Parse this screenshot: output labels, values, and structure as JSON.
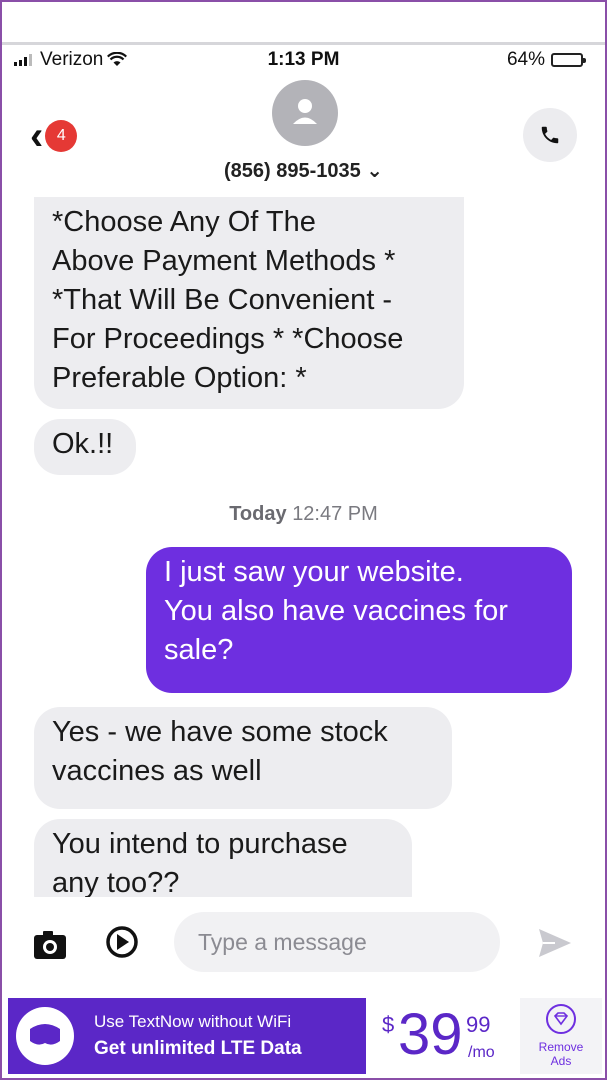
{
  "status_bar": {
    "carrier": "Verizon",
    "time": "1:13 PM",
    "battery_percent": "64%",
    "battery_level": 0.64
  },
  "header": {
    "unread_count": "4",
    "contact": "(856) 895-1035 ⌄"
  },
  "thread": {
    "messages": [
      {
        "direction": "incoming",
        "text": "*Choose Any Of The\nAbove Payment Methods *\n*That Will Be Convenient -\nFor Proceedings * *Choose\nPreferable Option: *"
      },
      {
        "direction": "incoming",
        "text": "Ok.!!"
      },
      {
        "direction": "outgoing",
        "text": "I just saw your website.\nYou also have vaccines for\nsale?"
      },
      {
        "direction": "incoming",
        "text": "Yes - we have some stock\nvaccines as well"
      },
      {
        "direction": "incoming",
        "text": "You intend to purchase\nany too??"
      }
    ],
    "timestamp_day": "Today",
    "timestamp_time": "12:47 PM"
  },
  "composer": {
    "placeholder": "Type a message"
  },
  "ad": {
    "line1": "Use TextNow without WiFi",
    "line2": "Get unlimited LTE Data",
    "currency": "$",
    "price_main": "39",
    "price_cents": "99",
    "price_unit": "/mo",
    "remove_ads": "Remove\nAds"
  },
  "colors": {
    "outgoing_bubble": "#6e2fe0",
    "incoming_bubble": "#ededf0",
    "ad_background": "#5b27c7",
    "badge": "#e53935"
  }
}
